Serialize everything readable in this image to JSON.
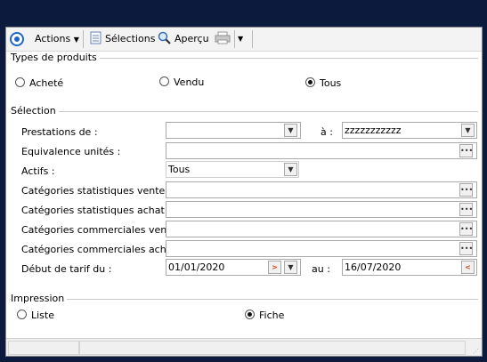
{
  "toolbar": {
    "actions_label": "Actions",
    "selections_label": "Sélections",
    "preview_label": "Aperçu"
  },
  "product_types": {
    "title": "Types de produits",
    "options": [
      {
        "label": "Acheté",
        "selected": false
      },
      {
        "label": "Vendu",
        "selected": false
      },
      {
        "label": "Tous",
        "selected": true
      }
    ]
  },
  "selection": {
    "title": "Sélection",
    "prestations_label": "Prestations de :",
    "prestations_from": "",
    "to_label": "à :",
    "prestations_to": "zzzzzzzzzzz",
    "equivalence_label": "Equivalence unités :",
    "equivalence_value": "",
    "actifs_label": "Actifs :",
    "actifs_value": "Tous",
    "cat_stat_vente_label": "Catégories statistiques vente :",
    "cat_stat_achat_label": "Catégories statistiques achat :",
    "cat_comm_vente_label": "Catégories commerciales vente :",
    "cat_comm_achat_label": "Catégories commerciales achat :",
    "tarif_label": "Début de tarif du :",
    "tarif_from": "01/01/2020",
    "au_label": "au :",
    "tarif_to": "16/07/2020"
  },
  "impression": {
    "title": "Impression",
    "options": [
      {
        "label": "Liste",
        "selected": false
      },
      {
        "label": "Fiche",
        "selected": true
      }
    ]
  },
  "icons": {
    "app": "target-icon",
    "selections": "document-icon",
    "preview": "magnifier-icon",
    "print": "printer-icon"
  },
  "colors": {
    "desktop": "#0b1a3d",
    "accent": "#1e66c9",
    "date_button": "#d24a1a"
  }
}
